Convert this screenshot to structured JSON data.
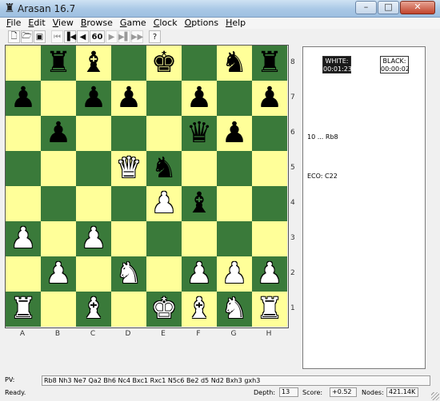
{
  "window": {
    "title": "Arasan 16.7",
    "app_icon": "♜",
    "minimize": "–",
    "maximize": "□",
    "close": "✕"
  },
  "menu": [
    "File",
    "Edit",
    "View",
    "Browse",
    "Game",
    "Clock",
    "Options",
    "Help"
  ],
  "toolbar": {
    "new_glyph": "🗋",
    "open_glyph": "🗁",
    "save_glyph": "▣",
    "first_glyph": "⏮",
    "start_glyph": "⏭",
    "back_glyph": "◀",
    "move_number": "60",
    "fwd_glyph": "▶",
    "end_glyph": "⏭",
    "last_glyph": "⏭",
    "hint_glyph": "?"
  },
  "board": {
    "light_color": "#ffff99",
    "dark_color": "#3a7a3a",
    "files": [
      "A",
      "B",
      "C",
      "D",
      "E",
      "F",
      "G",
      "H"
    ],
    "ranks": [
      "8",
      "7",
      "6",
      "5",
      "4",
      "3",
      "2",
      "1"
    ],
    "squares": [
      [
        "",
        "br",
        "bb",
        "",
        "bk",
        "",
        "bn",
        "br"
      ],
      [
        "bp",
        "",
        "bp",
        "bp",
        "",
        "bp",
        "",
        "bp"
      ],
      [
        "",
        "bp",
        "",
        "",
        "",
        "bq",
        "bp",
        ""
      ],
      [
        "",
        "",
        "",
        "wq",
        "bn",
        "",
        "",
        ""
      ],
      [
        "",
        "",
        "",
        "",
        "wp",
        "bb",
        "",
        ""
      ],
      [
        "wp",
        "",
        "wp",
        "",
        "",
        "",
        "",
        ""
      ],
      [
        "",
        "wp",
        "",
        "wn",
        "",
        "wp",
        "wp",
        "wp"
      ],
      [
        "wr",
        "",
        "wb",
        "",
        "wk",
        "wb",
        "wn",
        "wr"
      ]
    ]
  },
  "clocks": {
    "white_label": "WHITE:",
    "white_time": "00:01:23",
    "black_label": "BLACK:",
    "black_time": "00:00:02"
  },
  "last_move": "10 ... Rb8",
  "eco": "ECO: C22",
  "pv": {
    "label": "PV:",
    "line": "Rb8 Nh3 Ne7 Qa2 Bh6 Nc4 Bxc1 Rxc1 N5c6 Be2 d5 Nd2 Bxh3 gxh3"
  },
  "status": {
    "ready": "Ready.",
    "depth_label": "Depth:",
    "depth_value": "13",
    "score_label": "Score:",
    "score_value": "+0.52",
    "nodes_label": "Nodes:",
    "nodes_value": "421.14K"
  }
}
